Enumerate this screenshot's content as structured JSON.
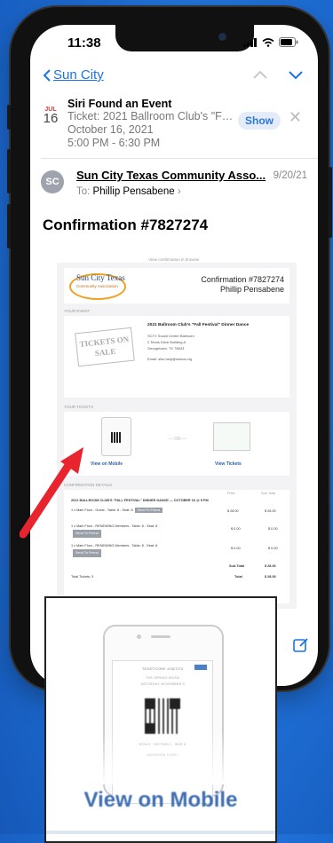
{
  "status": {
    "time": "11:38"
  },
  "nav": {
    "back_label": "Sun City"
  },
  "siri": {
    "title": "Siri Found an Event",
    "cal_month": "JUL",
    "cal_day": "16",
    "line1": "Ticket: 2021 Ballroom Club's \"Fall Fe...",
    "line2": "October 16, 2021",
    "line3": "5:00 PM - 6:30 PM",
    "show_label": "Show"
  },
  "sender": {
    "initials": "SC",
    "name": "Sun City Texas Community Asso...",
    "date": "9/20/21",
    "to_label": "To:",
    "to_name": "Phillip Pensabene"
  },
  "subject": "Confirmation #7827274",
  "email": {
    "view_in_browser": "View confirmation in browser",
    "logo_line1": "Sun City Texas",
    "logo_line2": "Community Association",
    "conf_number": "Confirmation #7827274",
    "recipient": "Phillip Pensabene",
    "your_event_label": "YOUR EVENT",
    "tickets_image_text": "TICKETS ON SALE",
    "event_title": "2021 Ballroom Club's \"Fall Festival\" Dinner Dance",
    "venue1": "SCTX Social Center Ballroom",
    "venue2": "2 Texas Drive Building A",
    "venue3": "Georgetown, TX 78633",
    "email_line": "Email: sfsc.help@sctxca.org",
    "your_tickets_label": "YOUR TICKETS",
    "view_on_mobile": "View on Mobile",
    "or_label": "— OR —",
    "view_tickets": "View Tickets",
    "details_label": "CONFIRMATION DETAILS",
    "col_price": "Price",
    "col_subtotal": "Sub-Total",
    "details_event": "2021 BALLROOM CLUB'S \"FALL FESTIVAL\" DINNER DANCE — OCTOBER 16 @ 5 PM",
    "items": [
      {
        "desc": "1 x Main Floor - Guest - Table: 8 - Seat: 8",
        "button": "Send To Friend",
        "price": "$ 28.00",
        "total": "$ 28.00"
      },
      {
        "desc": "1 x Main Floor - RENEWING Members - Table: 8 - Seat: 8",
        "button": "Send To Friend",
        "price": "$ 0.00",
        "total": "$ 0.00"
      },
      {
        "desc": "1 x Main Floor - RENEWING Members - Table: 8 - Seat: 8",
        "button": "Send To Friend",
        "price": "$ 0.00",
        "total": "$ 0.00"
      }
    ],
    "subtotal_label": "Sub-Total",
    "subtotal": "$ 28.00",
    "total_tickets": "Total Tickets: 3",
    "total_label": "Total",
    "total": "$ 28.00"
  },
  "zoom": {
    "ticket_header": "TICKET/CONF. #7827274",
    "ticket_l1": "THE SPRING SHOW",
    "ticket_l2": "SATURDAY, NOVEMBER 9",
    "ticket_seat": "ROW E · SECTION 1 · SEAT 8",
    "ticket_foot": "ADMISSION TICKET",
    "label": "View on Mobile"
  },
  "colors": {
    "accent": "#1a73e8",
    "arrow": "#e8242e",
    "background": "#1f6fd6"
  }
}
